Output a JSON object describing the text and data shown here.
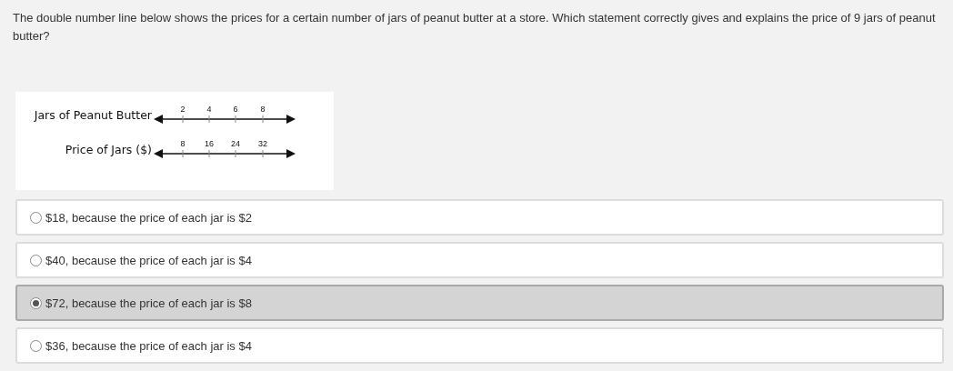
{
  "question": "The double number line below shows the prices for a certain number of jars of peanut butter at a store. Which statement correctly gives and explains the price of 9 jars of peanut butter?",
  "figure": {
    "lines": [
      {
        "label": "Jars of Peanut Butter",
        "ticks": [
          "2",
          "4",
          "6",
          "8"
        ]
      },
      {
        "label": "Price of Jars ($)",
        "ticks": [
          "8",
          "16",
          "24",
          "32"
        ]
      }
    ]
  },
  "options": [
    {
      "text": "$18, because the price of each jar is $2",
      "selected": false
    },
    {
      "text": "$40, because the price of each jar is $4",
      "selected": false
    },
    {
      "text": "$72, because the price of each jar is $8",
      "selected": true
    },
    {
      "text": "$36, because the price of each jar is $4",
      "selected": false
    }
  ]
}
